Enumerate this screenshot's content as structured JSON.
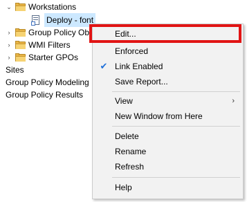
{
  "tree": {
    "items": [
      {
        "label": "Workstations",
        "icon": "folder-icon",
        "expander": "expanded"
      },
      {
        "label": "Deploy - font",
        "icon": "gpo-link-icon"
      },
      {
        "label": "Group Policy Ob",
        "icon": "folder-icon",
        "expander": "collapsed"
      },
      {
        "label": "WMI Filters",
        "icon": "folder-icon",
        "expander": "collapsed"
      },
      {
        "label": "Starter GPOs",
        "icon": "folder-icon",
        "expander": "collapsed"
      },
      {
        "label": "Sites"
      },
      {
        "label": "Group Policy Modeling"
      },
      {
        "label": "Group Policy Results"
      }
    ]
  },
  "context_menu": {
    "items": [
      {
        "label": "Edit..."
      },
      {
        "label": "Enforced"
      },
      {
        "label": "Link Enabled",
        "checked": true
      },
      {
        "label": "Save Report..."
      },
      {
        "label": "View",
        "submenu": true
      },
      {
        "label": "New Window from Here"
      },
      {
        "label": "Delete"
      },
      {
        "label": "Rename"
      },
      {
        "label": "Refresh"
      },
      {
        "label": "Help"
      }
    ],
    "highlight_color": "#e11414"
  },
  "colors": {
    "menu_bg": "#f2f2f2",
    "selection_bg": "#cce8ff",
    "check": "#1e6fd9"
  }
}
